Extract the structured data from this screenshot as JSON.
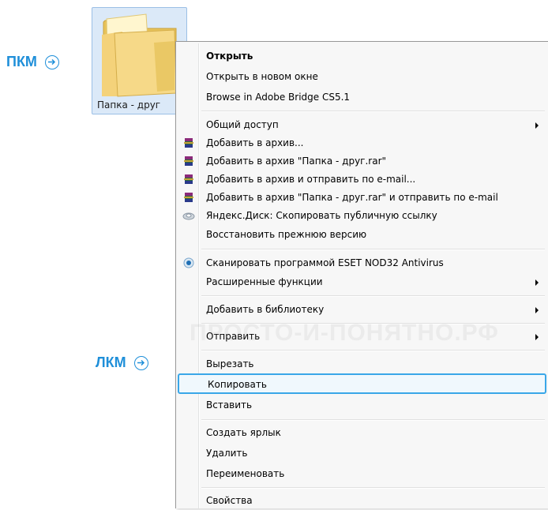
{
  "folder": {
    "label": "Папка - друг"
  },
  "annotations": {
    "right_click": "ПКМ",
    "left_click": "ЛКМ"
  },
  "watermark": "ПРОСТО-И-ПОНЯТНО.РФ",
  "colors": {
    "accent": "#1f8fd9",
    "highlight_border": "#3aa7e8",
    "menu_bg": "#f7f7f7",
    "folder_selected_bg": "#dbe9f8"
  },
  "menu": {
    "items": [
      {
        "label": "Открыть",
        "bold": true
      },
      {
        "label": "Открыть в новом окне"
      },
      {
        "label": "Browse in Adobe Bridge CS5.1"
      },
      {
        "label": "Общий доступ",
        "submenu": true
      },
      {
        "label": "Добавить в архив...",
        "icon": "winrar-icon"
      },
      {
        "label": "Добавить в архив \"Папка - друг.rar\"",
        "icon": "winrar-icon"
      },
      {
        "label": "Добавить в архив и отправить по e-mail...",
        "icon": "winrar-icon"
      },
      {
        "label": "Добавить в архив \"Папка - друг.rar\" и отправить по e-mail",
        "icon": "winrar-icon"
      },
      {
        "label": "Яндекс.Диск: Скопировать публичную ссылку",
        "icon": "yandex-disk-icon"
      },
      {
        "label": "Восстановить прежнюю версию"
      },
      {
        "label": "Сканировать программой ESET NOD32 Antivirus",
        "icon": "eset-icon"
      },
      {
        "label": "Расширенные функции",
        "submenu": true
      },
      {
        "label": "Добавить в библиотеку",
        "submenu": true
      },
      {
        "label": "Отправить",
        "submenu": true
      },
      {
        "label": "Вырезать"
      },
      {
        "label": "Копировать",
        "highlighted": true
      },
      {
        "label": "Вставить"
      },
      {
        "label": "Создать ярлык"
      },
      {
        "label": "Удалить"
      },
      {
        "label": "Переименовать"
      },
      {
        "label": "Свойства"
      }
    ]
  }
}
